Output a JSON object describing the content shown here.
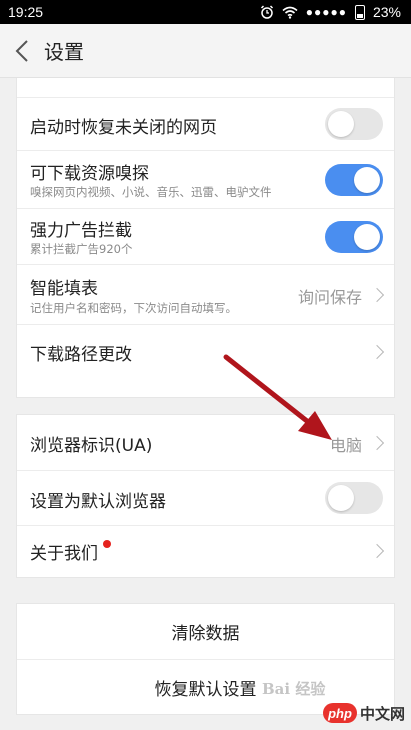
{
  "status_bar": {
    "time": "19:25",
    "signal_dots": "●●●●●",
    "battery_percent": "23%",
    "icons": [
      "alarm-icon",
      "wifi-icon",
      "signal-icon",
      "battery-icon"
    ]
  },
  "header": {
    "title": "设置",
    "back_icon": "chevron-left-icon"
  },
  "settings": {
    "restore_tabs": {
      "title": "启动时恢复未关闭的网页",
      "enabled": false
    },
    "resource_sniff": {
      "title": "可下载资源嗅探",
      "subtitle": "嗅探网页内视频、小说、音乐、迅雷、电驴文件",
      "enabled": true
    },
    "ad_block": {
      "title": "强力广告拦截",
      "subtitle": "累计拦截广告920个",
      "enabled": true
    },
    "autofill": {
      "title": "智能填表",
      "subtitle": "记住用户名和密码，下次访问自动填写。",
      "value": "询问保存"
    },
    "download_path": {
      "title": "下载路径更改"
    },
    "user_agent": {
      "title": "浏览器标识(UA)",
      "value": "电脑"
    },
    "default_browser": {
      "title": "设置为默认浏览器",
      "enabled": false
    },
    "about": {
      "title": "关于我们",
      "has_badge": true
    }
  },
  "actions": {
    "clear_data": "清除数据",
    "restore_defaults": "恢复默认设置"
  },
  "colors": {
    "toggle_on": "#4a8ef0",
    "toggle_off": "#e6e6e6",
    "annotation_arrow": "#b0151c",
    "badge": "#e5221e"
  },
  "watermarks": {
    "baidu": "Bai 经验",
    "php_logo": "php",
    "php_text": "中文网"
  }
}
